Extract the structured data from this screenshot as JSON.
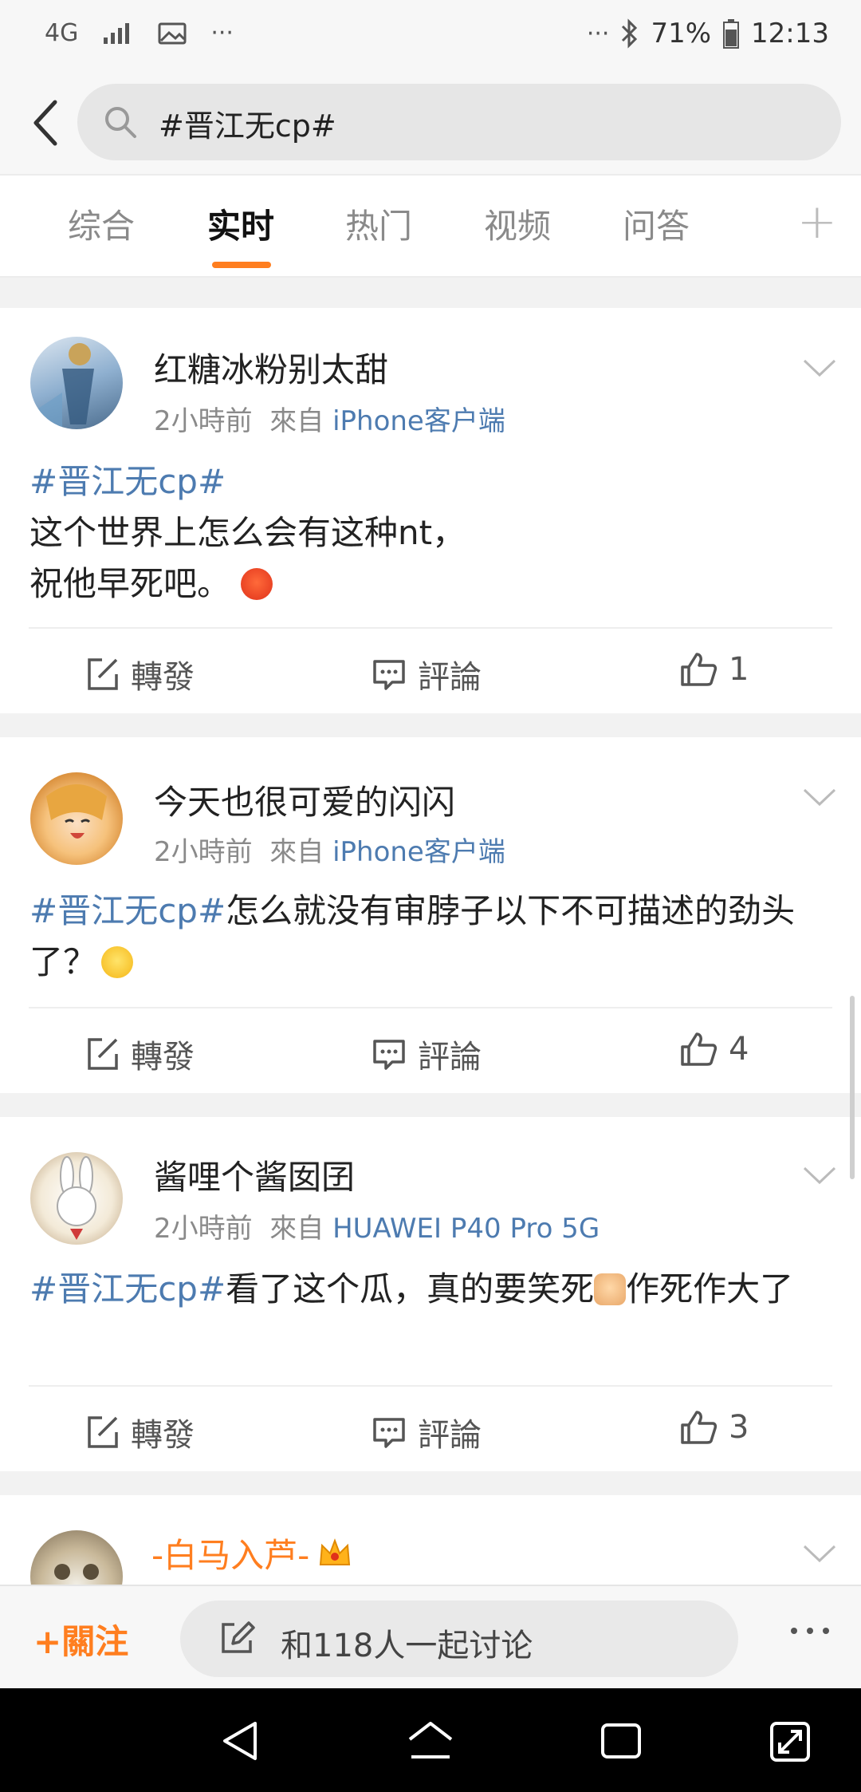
{
  "status_bar": {
    "network": "4G",
    "battery": "71%",
    "time": "12:13",
    "left_dots": "···",
    "right_dots": "···"
  },
  "search": {
    "query": "#晋江无cp#"
  },
  "tabs": [
    {
      "label": "综合",
      "active": false
    },
    {
      "label": "实时",
      "active": true
    },
    {
      "label": "热门",
      "active": false
    },
    {
      "label": "视频",
      "active": false
    },
    {
      "label": "问答",
      "active": false
    }
  ],
  "tabs_plus": "+",
  "posts": [
    {
      "author": "红糖冰粉别太甜",
      "time": "2小時前",
      "from_label": "來自",
      "source": "iPhone客户端",
      "hashtag": "#晋江无cp#",
      "text_line1": "这个世界上怎么会有这种nt，",
      "text_line2": "祝他早死吧。",
      "repost": "轉發",
      "comment": "評論",
      "likes": "1"
    },
    {
      "author": "今天也很可爱的闪闪",
      "time": "2小時前",
      "from_label": "來自",
      "source": "iPhone客户端",
      "hashtag": "#晋江无cp#",
      "text": "怎么就没有审脖子以下不可描述的劲头了？",
      "repost": "轉發",
      "comment": "評論",
      "likes": "4"
    },
    {
      "author": "酱哩个酱囡囝",
      "time": "2小時前",
      "from_label": "來自",
      "source": "HUAWEI P40 Pro 5G",
      "hashtag": "#晋江无cp#",
      "text_a": "看了这个瓜，真的要笑死",
      "text_b": "作死作大了",
      "repost": "轉發",
      "comment": "評論",
      "likes": "3"
    },
    {
      "author": "-白马入芦-"
    }
  ],
  "bottom": {
    "follow": "關注",
    "follow_plus": "+",
    "discuss": "和118人一起讨论"
  },
  "colors": {
    "accent": "#ff7e1f",
    "link": "#4d7bb0"
  }
}
